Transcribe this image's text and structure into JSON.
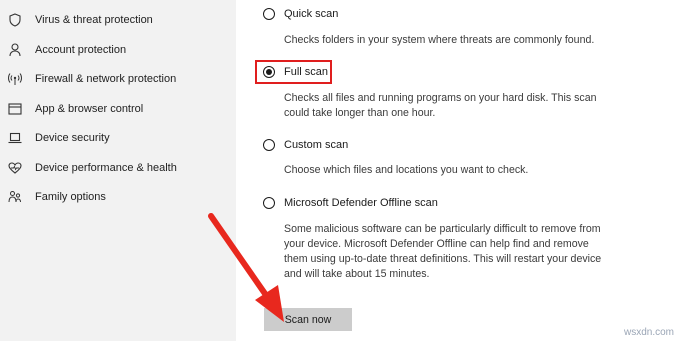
{
  "sidebar": {
    "items": [
      {
        "label": "Virus & threat protection",
        "icon": "shield-icon"
      },
      {
        "label": "Account protection",
        "icon": "person-icon"
      },
      {
        "label": "Firewall & network protection",
        "icon": "wifi-antenna-icon"
      },
      {
        "label": "App & browser control",
        "icon": "browser-window-icon"
      },
      {
        "label": "Device security",
        "icon": "laptop-icon"
      },
      {
        "label": "Device performance & health",
        "icon": "heart-icon"
      },
      {
        "label": "Family options",
        "icon": "family-icon"
      }
    ]
  },
  "scan_options": [
    {
      "label": "Quick scan",
      "selected": false,
      "description": "Checks folders in your system where threats are commonly found."
    },
    {
      "label": "Full scan",
      "selected": true,
      "description": "Checks all files and running programs on your hard disk. This scan could take longer than one hour."
    },
    {
      "label": "Custom scan",
      "selected": false,
      "description": "Choose which files and locations you want to check."
    },
    {
      "label": "Microsoft Defender Offline scan",
      "selected": false,
      "description": "Some malicious software can be particularly difficult to remove from your device. Microsoft Defender Offline can help find and remove them using up-to-date threat definitions. This will restart your device and will take about 15 minutes."
    }
  ],
  "scan_button": {
    "label": "Scan now"
  },
  "watermark": "wsxdn.com",
  "colors": {
    "highlight": "#e01e1e",
    "arrow": "#e8281e",
    "sidebar_bg": "#f2f2f2",
    "button_bg": "#cccccc"
  }
}
